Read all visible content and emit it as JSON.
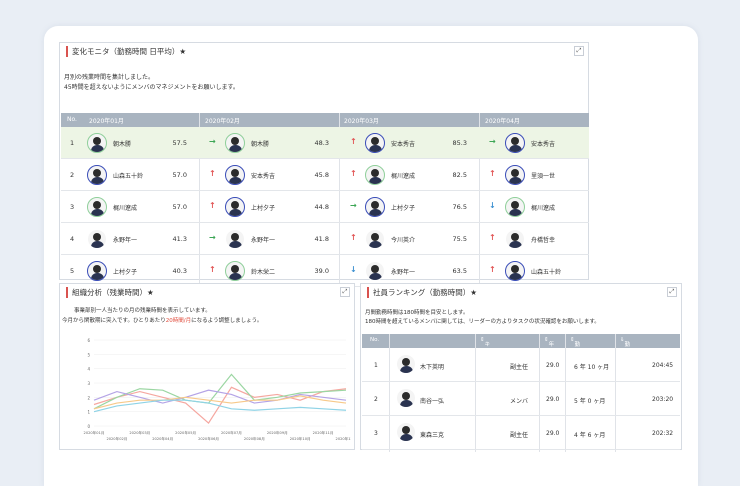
{
  "monitor": {
    "title": "変化モニタ（勤務時間 日平均）★",
    "desc1": "月別の残業時間を集計しました。",
    "desc2": "45時間を超えないようにメンバのマネジメントをお願いします。",
    "headers": [
      "No.",
      "2020年01月",
      "2020年02月",
      "2020年03月",
      "2020年04月"
    ],
    "rows": [
      {
        "no": "1",
        "m1": {
          "name": "朝木勝",
          "val": "57.5"
        },
        "m2": {
          "arrow": "→",
          "name": "朝木勝",
          "val": "48.3"
        },
        "m3": {
          "arrow": "↑",
          "name": "安本秀吉",
          "val": "85.3"
        },
        "m4": {
          "arrow": "→",
          "name": "安本秀吉"
        }
      },
      {
        "no": "2",
        "m1": {
          "name": "山森五十鈴",
          "val": "57.0"
        },
        "m2": {
          "arrow": "↑",
          "name": "安本秀吉",
          "val": "45.8"
        },
        "m3": {
          "arrow": "↑",
          "name": "梶川遼成",
          "val": "82.5"
        },
        "m4": {
          "arrow": "↑",
          "name": "里須一世"
        }
      },
      {
        "no": "3",
        "m1": {
          "name": "梶川遼成",
          "val": "57.0"
        },
        "m2": {
          "arrow": "↑",
          "name": "上村夕子",
          "val": "44.8"
        },
        "m3": {
          "arrow": "→",
          "name": "上村夕子",
          "val": "76.5"
        },
        "m4": {
          "arrow": "↓",
          "name": "梶川遼成"
        }
      },
      {
        "no": "4",
        "m1": {
          "name": "永野年一",
          "val": "41.3"
        },
        "m2": {
          "arrow": "→",
          "name": "永野年一",
          "val": "41.8"
        },
        "m3": {
          "arrow": "↑",
          "name": "今川英介",
          "val": "75.5"
        },
        "m4": {
          "arrow": "↑",
          "name": "舟橋哲幸"
        }
      },
      {
        "no": "5",
        "m1": {
          "name": "上村夕子",
          "val": "40.3"
        },
        "m2": {
          "arrow": "↑",
          "name": "鈴木栄二",
          "val": "39.0"
        },
        "m3": {
          "arrow": "↓",
          "name": "永野年一",
          "val": "63.5"
        },
        "m4": {
          "arrow": "↑",
          "name": "山森五十鈴"
        }
      }
    ]
  },
  "org": {
    "title": "組織分析（残業時間）★",
    "desc1": "事業部別一人当たりの月の残業時間を表示しています。",
    "desc2a": "今月から閑散期に突入です。ひとりあたり",
    "desc2b": "20時間/月",
    "desc2c": "になるよう調整しましょう。"
  },
  "chart_data": {
    "type": "line",
    "ylim": [
      0,
      6
    ],
    "yticks": [
      "0",
      "1",
      "2",
      "3",
      "4",
      "5",
      "6"
    ],
    "x": [
      "2020年01月",
      "2020年02月",
      "2020年03月",
      "2020年04月",
      "2020年05月",
      "2020年06月",
      "2020年07月",
      "2020年08月",
      "2020年09月",
      "2020年10月",
      "2020年11月",
      "2020年12月"
    ],
    "series": [
      {
        "color": "#f5a7a0",
        "values": [
          1.5,
          2.0,
          2.4,
          2.0,
          1.6,
          0.2,
          2.7,
          2.0,
          2.2,
          1.8,
          2.4,
          2.6
        ]
      },
      {
        "color": "#9bd6a2",
        "values": [
          1.2,
          2.0,
          2.6,
          2.5,
          1.8,
          1.6,
          3.6,
          1.8,
          2.0,
          2.3,
          2.4,
          2.5
        ]
      },
      {
        "color": "#b4a3e6",
        "values": [
          1.8,
          2.4,
          2.0,
          1.6,
          2.0,
          2.5,
          2.2,
          1.6,
          1.8,
          2.2,
          2.0,
          1.8
        ]
      },
      {
        "color": "#f7c98a",
        "values": [
          1.2,
          1.6,
          1.8,
          1.8,
          2.0,
          1.8,
          1.6,
          1.8,
          1.8,
          2.1,
          1.8,
          1.6
        ]
      },
      {
        "color": "#8fd3e6",
        "values": [
          1.0,
          1.4,
          1.6,
          1.8,
          1.8,
          1.6,
          1.2,
          1.1,
          1.2,
          1.3,
          1.2,
          1.1
        ]
      }
    ]
  },
  "ranking": {
    "title": "社員ランキング（勤務時間）★",
    "desc1": "月間勤務時間は180時間を目安とします。",
    "desc2": "180時間を超えているメンバに関しては、リーダーの方よりタスクの状況確認をお願いします。",
    "headers": [
      "No.",
      "キャリアステージ",
      "年齢",
      "勤続期間",
      "勤務時間(月平均)"
    ],
    "rows": [
      {
        "no": "1",
        "name": "木下英明",
        "stage": "副主任",
        "age": "29.0",
        "tenure": "6 年 10 ヶ月",
        "hours": "204:45"
      },
      {
        "no": "2",
        "name": "南谷一弘",
        "stage": "メンバ",
        "age": "29.0",
        "tenure": "5 年 0 ヶ月",
        "hours": "203:20"
      },
      {
        "no": "3",
        "name": "東森三克",
        "stage": "副主任",
        "age": "29.0",
        "tenure": "4 年 6 ヶ月",
        "hours": "202:32"
      }
    ]
  }
}
